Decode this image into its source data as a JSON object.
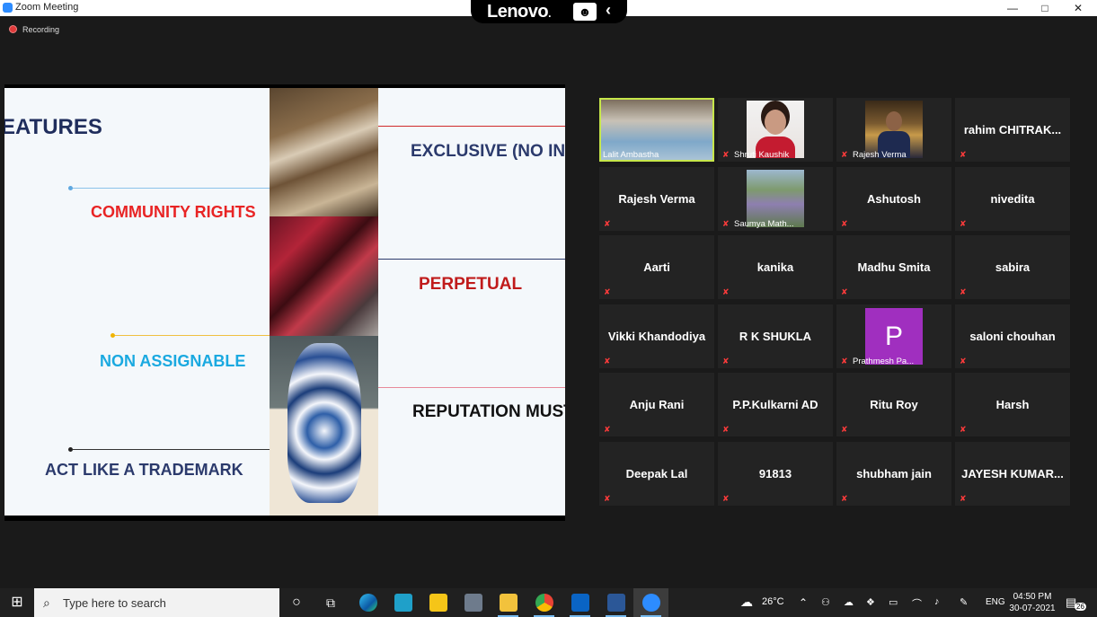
{
  "window": {
    "title": "Zoom Meeting",
    "controls": {
      "minimize": "—",
      "maximize": "□",
      "close": "✕"
    }
  },
  "overlay": {
    "brand": "Lenovo",
    "brand_suffix": "."
  },
  "recording": {
    "label": "Recording"
  },
  "slide": {
    "features": "EATURES",
    "community_rights": "COMMUNITY RIGHTS",
    "non_assignable": "NON ASSIGNABLE",
    "act_like_trademark": "ACT LIKE  A TRADEMARK",
    "exclusive": "EXCLUSIVE (NO IND",
    "perpetual": "PERPETUAL",
    "reputation": "REPUTATION MUST"
  },
  "participants": [
    {
      "name": "Lalit Ambastha",
      "video": true,
      "active": true
    },
    {
      "name": "Shruti Kaushik",
      "video": true
    },
    {
      "name": "Rajesh Verma",
      "video": true
    },
    {
      "name": "rahim  CHITRAK...",
      "video": false
    },
    {
      "name": "Rajesh Verma",
      "video": false
    },
    {
      "name": "Saumya Math...",
      "video": true
    },
    {
      "name": "Ashutosh",
      "video": false
    },
    {
      "name": "nivedita",
      "video": false
    },
    {
      "name": "Aarti",
      "video": false
    },
    {
      "name": "kanika",
      "video": false
    },
    {
      "name": "Madhu Smita",
      "video": false
    },
    {
      "name": "sabira",
      "video": false
    },
    {
      "name": "Vikki Khandodiya",
      "video": false
    },
    {
      "name": "R K SHUKLA",
      "video": false
    },
    {
      "name": "Prathmesh Pa...",
      "video": false,
      "avatar_letter": "P"
    },
    {
      "name": "saloni chouhan",
      "video": false
    },
    {
      "name": "Anju Rani",
      "video": false
    },
    {
      "name": "P.P.Kulkarni AD",
      "video": false
    },
    {
      "name": "Ritu Roy",
      "video": false
    },
    {
      "name": "Harsh",
      "video": false
    },
    {
      "name": "Deepak Lal",
      "video": false
    },
    {
      "name": "91813",
      "video": false
    },
    {
      "name": "shubham jain",
      "video": false
    },
    {
      "name": "JAYESH  KUMAR...",
      "video": false
    }
  ],
  "taskbar": {
    "search_placeholder": "Type here to search",
    "weather": "26°C",
    "language": "ENG",
    "time": "04:50 PM",
    "date": "30-07-2021",
    "notifications": "26"
  },
  "colors": {
    "active_speaker": "#c6e64a",
    "muted_icon": "#ff3b3b",
    "avatar_p": "#a02fbf",
    "zoom_blue": "#2d8cff"
  }
}
